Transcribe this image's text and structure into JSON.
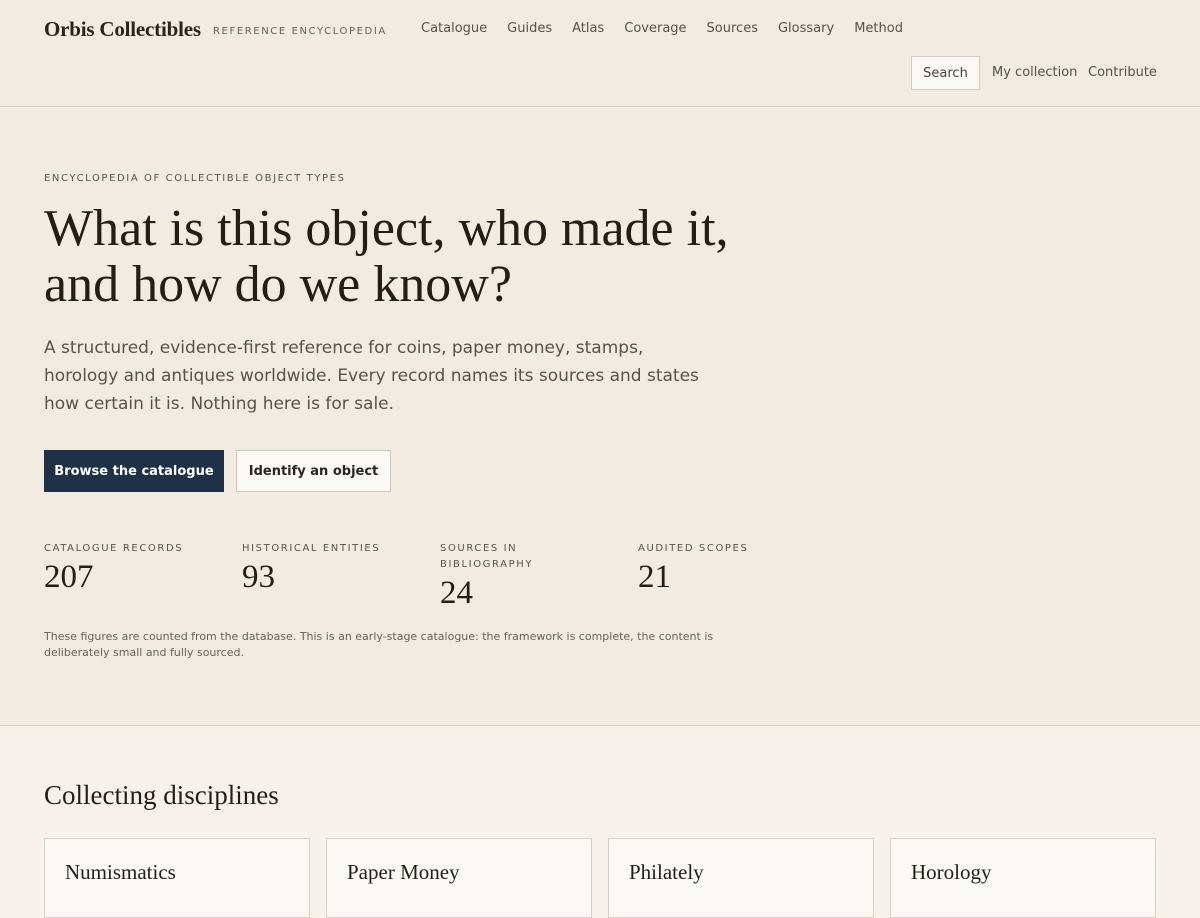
{
  "header": {
    "brand": "Orbis Collectibles",
    "brand_tag": "REFERENCE ENCYCLOPEDIA",
    "nav": [
      "Catalogue",
      "Guides",
      "Atlas",
      "Coverage",
      "Sources",
      "Glossary",
      "Method"
    ],
    "search_label": "Search",
    "my_collection": "My collection",
    "contribute": "Contribute"
  },
  "hero": {
    "eyebrow": "ENCYCLOPEDIA OF COLLECTIBLE OBJECT TYPES",
    "title": "What is this object, who made it, and how do we know?",
    "lead": "A structured, evidence-first reference for coins, paper money, stamps, horology and antiques worldwide. Every record names its sources and states how certain it is. Nothing here is for sale.",
    "primary_button": "Browse the catalogue",
    "secondary_button": "Identify an object",
    "stats": [
      {
        "label": "CATALOGUE RECORDS",
        "value": "207"
      },
      {
        "label": "HISTORICAL ENTITIES",
        "value": "93"
      },
      {
        "label": "SOURCES IN BIBLIOGRAPHY",
        "value": "24"
      },
      {
        "label": "AUDITED SCOPES",
        "value": "21"
      }
    ],
    "note": "These figures are counted from the database. This is an early-stage catalogue: the framework is complete, the content is deliberately small and fully sourced."
  },
  "disciplines": {
    "title": "Collecting disciplines",
    "cards": [
      "Numismatics",
      "Paper Money",
      "Philately",
      "Horology"
    ]
  }
}
